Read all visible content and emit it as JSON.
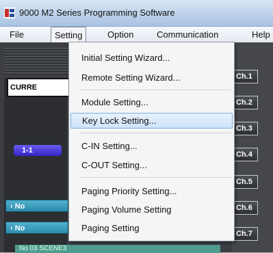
{
  "window": {
    "title": "9000 M2 Series Programming Software"
  },
  "menubar": {
    "items": [
      "File",
      "Setting",
      "Option",
      "Communication",
      "Help"
    ],
    "active": "Setting"
  },
  "setting_menu": {
    "items": [
      "Initial Setting Wizard...",
      "Remote Setting Wizard...",
      "Module Setting...",
      "Key Lock Setting...",
      "C-IN Setting...",
      "C-OUT Setting...",
      "Paging Priority Setting...",
      "Paging Volume Setting",
      "Paging Setting"
    ],
    "highlighted": "Key Lock Setting..."
  },
  "workspace": {
    "current_label": "CURRE",
    "badge": "1-1",
    "no_rows": [
      "No",
      "No"
    ],
    "bottom_row": "No 03  SCENE3"
  },
  "channels": [
    "Ch.1",
    "Ch.2",
    "Ch.3",
    "Ch.4",
    "Ch.5",
    "Ch.6",
    "Ch.7"
  ],
  "colors": {
    "menu_highlight": "#cfe3f8",
    "channel_bg": "#2d2f33",
    "badge": "#3424c7",
    "row_teal": "#2d8bab"
  }
}
